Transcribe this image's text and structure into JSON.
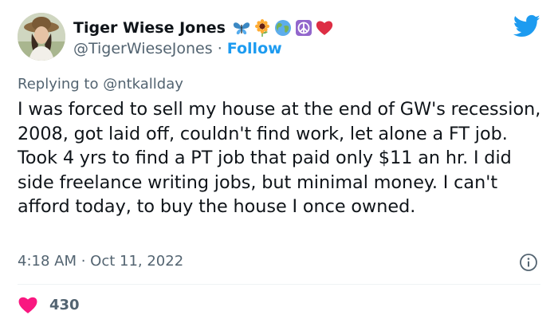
{
  "author": {
    "display_name": "Tiger Wiese Jones",
    "handle": "@TigerWieseJones",
    "separator": " · ",
    "follow_label": "Follow",
    "name_emojis": [
      "butterfly-emoji",
      "sunflower-emoji",
      "globe-emoji",
      "peace-emoji",
      "red-heart-emoji"
    ]
  },
  "reply": {
    "prefix": "Replying to ",
    "mention": "@ntkallday"
  },
  "tweet": {
    "text": "I was forced to sell my house at the end of GW's recession, 2008, got laid off, couldn't find work, let alone a FT job. Took 4 yrs to find a PT job that paid only $11 an hr. I did side freelance writing jobs, but minimal money. I can't afford today, to buy the house I once owned.",
    "timestamp": "4:18 AM · Oct 11, 2022"
  },
  "engagement": {
    "like_count": "430"
  },
  "icons": {
    "brand": "twitter-bird-icon",
    "info": "info-icon",
    "like": "heart-icon"
  },
  "colors": {
    "brand_blue": "#1d9bf0",
    "heart_pink": "#f91880",
    "muted_text": "#536471"
  }
}
